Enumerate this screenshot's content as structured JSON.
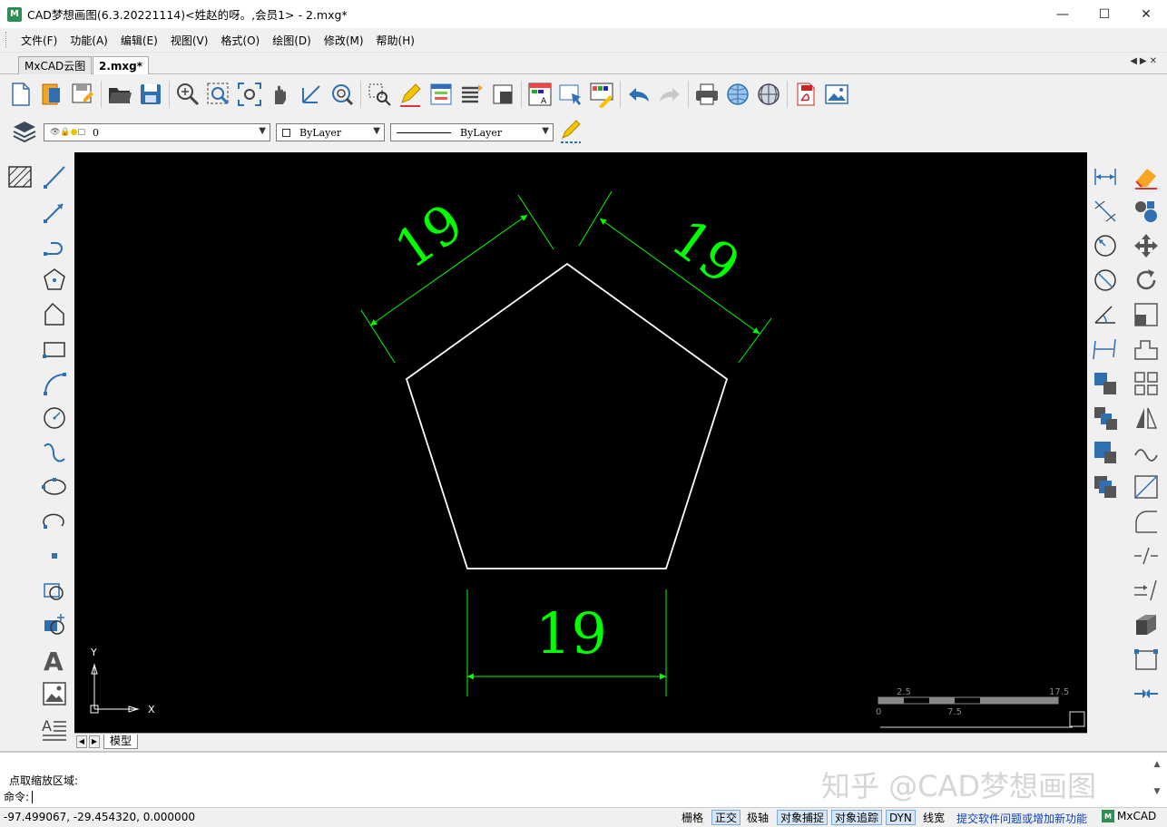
{
  "window": {
    "title": "CAD梦想画图(6.3.20221114)<姓赵的呀。,会员1> - 2.mxg*",
    "app_icon_text": "M",
    "minimize": "—",
    "maximize": "☐",
    "close": "✕"
  },
  "menu": [
    "文件(F)",
    "功能(A)",
    "编辑(E)",
    "视图(V)",
    "格式(O)",
    "绘图(D)",
    "修改(M)",
    "帮助(H)"
  ],
  "doc_tabs": [
    "MxCAD云图",
    "2.mxg*"
  ],
  "layer_combo": {
    "value": "0"
  },
  "color_combo": {
    "value": "ByLayer"
  },
  "linetype_combo": {
    "value": "ByLayer"
  },
  "drawing": {
    "dim_top_left": "19",
    "dim_top_right": "19",
    "dim_bottom": "19",
    "ucs_x": "X",
    "ucs_y": "Y",
    "scale_labels": [
      "2.5",
      "17.5",
      "0",
      "7.5"
    ],
    "colors": {
      "background": "#000000",
      "geometry": "#ffffff",
      "dimension": "#00ff00"
    }
  },
  "layout_tab": "模型",
  "command": {
    "history": "点取缩放区域:",
    "prompt": "命令:"
  },
  "watermark": "知乎 @CAD梦想画图",
  "status": {
    "coords": "-97.499067,  -29.454320,  0.000000",
    "buttons": [
      "栅格",
      "正交",
      "极轴",
      "对象捕捉",
      "对象追踪",
      "DYN",
      "线宽"
    ],
    "link": "提交软件问题或增加新功能",
    "brand": "MxCAD",
    "brand_icon_text": "M"
  }
}
